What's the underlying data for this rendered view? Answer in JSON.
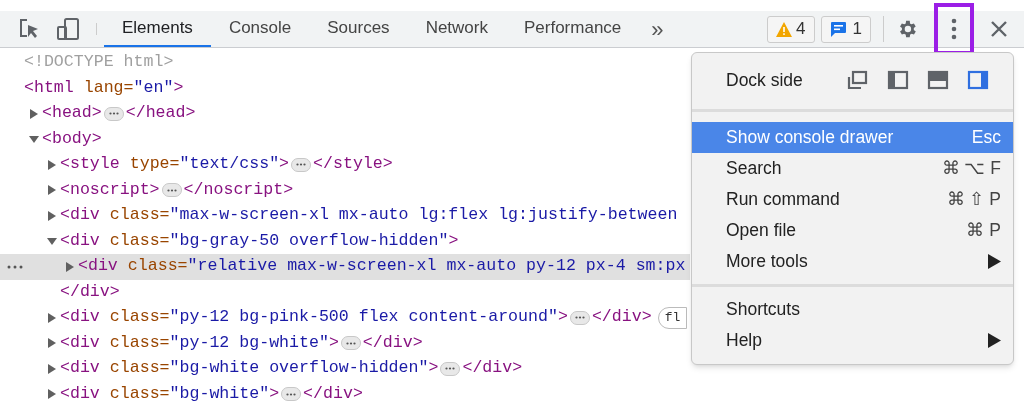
{
  "toolbar": {
    "tabs": [
      {
        "label": "Elements",
        "selected": true
      },
      {
        "label": "Console",
        "selected": false
      },
      {
        "label": "Sources",
        "selected": false
      },
      {
        "label": "Network",
        "selected": false
      },
      {
        "label": "Performance",
        "selected": false
      }
    ],
    "more_tabs": "»",
    "warnings": "4",
    "messages": "1",
    "menu_button_highlighted": true
  },
  "dom_tree": [
    {
      "tokens": [
        {
          "kind": "doctype",
          "text": "<!DOCTYPE html>"
        }
      ]
    },
    {
      "tokens": [
        {
          "kind": "tag",
          "text": "<html "
        },
        {
          "kind": "attr",
          "text": "lang="
        },
        {
          "kind": "value",
          "text": "\"en\""
        },
        {
          "kind": "tag",
          "text": ">"
        }
      ],
      "children": [
        {
          "expanded": false,
          "tokens": [
            {
              "kind": "tag",
              "text": "<head>"
            },
            {
              "kind": "ellipsis"
            },
            {
              "kind": "tag",
              "text": "</head>"
            }
          ]
        },
        {
          "expanded": true,
          "tokens": [
            {
              "kind": "tag",
              "text": "<body>"
            }
          ],
          "children": [
            {
              "expanded": false,
              "tokens": [
                {
                  "kind": "tag",
                  "text": "<style "
                },
                {
                  "kind": "attr",
                  "text": "type="
                },
                {
                  "kind": "value",
                  "text": "\"text/css\""
                },
                {
                  "kind": "tag",
                  "text": ">"
                },
                {
                  "kind": "ellipsis"
                },
                {
                  "kind": "tag",
                  "text": "</style>"
                }
              ]
            },
            {
              "expanded": false,
              "tokens": [
                {
                  "kind": "tag",
                  "text": "<noscript>"
                },
                {
                  "kind": "ellipsis"
                },
                {
                  "kind": "tag",
                  "text": "</noscript>"
                }
              ]
            },
            {
              "expanded": false,
              "tokens": [
                {
                  "kind": "tag",
                  "text": "<div "
                },
                {
                  "kind": "attr",
                  "text": "class="
                },
                {
                  "kind": "value",
                  "text": "\"max-w-screen-xl mx-auto lg:flex lg:justify-between"
                }
              ]
            },
            {
              "expanded": true,
              "tokens": [
                {
                  "kind": "tag",
                  "text": "<div "
                },
                {
                  "kind": "attr",
                  "text": "class="
                },
                {
                  "kind": "value",
                  "text": "\"bg-gray-50 overflow-hidden\""
                },
                {
                  "kind": "tag",
                  "text": ">"
                }
              ],
              "closing": "</div>",
              "children": [
                {
                  "expanded": false,
                  "selected": true,
                  "tokens": [
                    {
                      "kind": "tag",
                      "text": "<div "
                    },
                    {
                      "kind": "attr",
                      "text": "class="
                    },
                    {
                      "kind": "value",
                      "text": "\"relative max-w-screen-xl mx-auto py-12 px-4 sm:px"
                    }
                  ]
                }
              ]
            },
            {
              "expanded": false,
              "tokens": [
                {
                  "kind": "tag",
                  "text": "<div "
                },
                {
                  "kind": "attr",
                  "text": "class="
                },
                {
                  "kind": "value",
                  "text": "\"py-12 bg-pink-500 flex content-around\""
                },
                {
                  "kind": "tag",
                  "text": ">"
                },
                {
                  "kind": "ellipsis"
                },
                {
                  "kind": "tag",
                  "text": "</div>"
                },
                {
                  "kind": "badge",
                  "text": "fl"
                }
              ]
            },
            {
              "expanded": false,
              "tokens": [
                {
                  "kind": "tag",
                  "text": "<div "
                },
                {
                  "kind": "attr",
                  "text": "class="
                },
                {
                  "kind": "value",
                  "text": "\"py-12 bg-white\""
                },
                {
                  "kind": "tag",
                  "text": ">"
                },
                {
                  "kind": "ellipsis"
                },
                {
                  "kind": "tag",
                  "text": "</div>"
                }
              ]
            },
            {
              "expanded": false,
              "tokens": [
                {
                  "kind": "tag",
                  "text": "<div "
                },
                {
                  "kind": "attr",
                  "text": "class="
                },
                {
                  "kind": "value",
                  "text": "\"bg-white overflow-hidden\""
                },
                {
                  "kind": "tag",
                  "text": ">"
                },
                {
                  "kind": "ellipsis"
                },
                {
                  "kind": "tag",
                  "text": "</div>"
                }
              ]
            },
            {
              "expanded": false,
              "tokens": [
                {
                  "kind": "tag",
                  "text": "<div "
                },
                {
                  "kind": "attr",
                  "text": "class="
                },
                {
                  "kind": "value",
                  "text": "\"bg-white\""
                },
                {
                  "kind": "tag",
                  "text": ">"
                },
                {
                  "kind": "ellipsis"
                },
                {
                  "kind": "tag",
                  "text": "</div>"
                }
              ]
            }
          ]
        }
      ]
    }
  ],
  "menu": {
    "dock_side": {
      "label": "Dock side",
      "options": [
        {
          "kind": "undock",
          "selected": false
        },
        {
          "kind": "left",
          "selected": false
        },
        {
          "kind": "bottom",
          "selected": false
        },
        {
          "kind": "right",
          "selected": true
        }
      ]
    },
    "items": [
      {
        "label": "Show console drawer",
        "shortcut": "Esc",
        "highlighted": true
      },
      {
        "label": "Search",
        "shortcut": "⌘ ⌥ F",
        "highlighted": false
      },
      {
        "label": "Run command",
        "shortcut": "⌘ ⇧ P",
        "highlighted": false
      },
      {
        "label": "Open file",
        "shortcut": "⌘ P",
        "highlighted": false
      },
      {
        "label": "More tools",
        "submenu": true,
        "highlighted": false
      },
      {
        "kind": "separator"
      },
      {
        "label": "Shortcuts",
        "highlighted": false
      },
      {
        "label": "Help",
        "submenu": true,
        "highlighted": false
      }
    ]
  }
}
